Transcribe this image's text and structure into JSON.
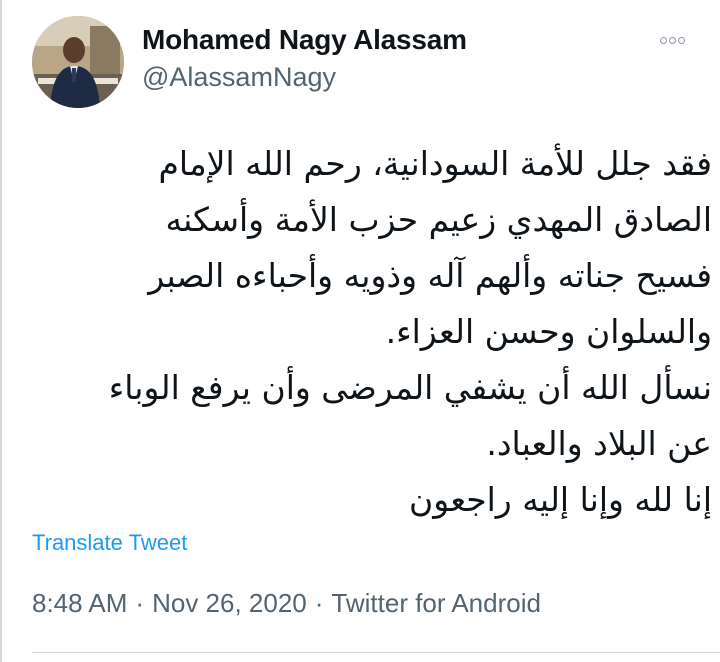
{
  "user": {
    "display_name": "Mohamed Nagy Alassam",
    "handle": "@AlassamNagy",
    "avatar_icon": "profile-photo"
  },
  "more_icon": "more-options-icon",
  "tweet": {
    "lines": [
      "فقد جلل للأمة السودانية، رحم الله الإمام",
      "الصادق المهدي زعيم حزب الأمة وأسكنه",
      "فسيح جناته وألهم آله وذويه وأحباءه الصبر",
      "والسلوان وحسن العزاء.",
      "نسأل الله أن يشفي المرضى وأن يرفع الوباء",
      "عن البلاد والعباد.",
      "إنا لله وإنا إليه راجعون"
    ]
  },
  "translate_label": "Translate Tweet",
  "meta": {
    "time": "8:48 AM",
    "separator": "·",
    "date": "Nov 26, 2020",
    "source": "Twitter for Android"
  },
  "colors": {
    "text": "#0f1419",
    "secondary": "#536471",
    "link": "#1d9bf0",
    "border": "#cfd9de"
  }
}
